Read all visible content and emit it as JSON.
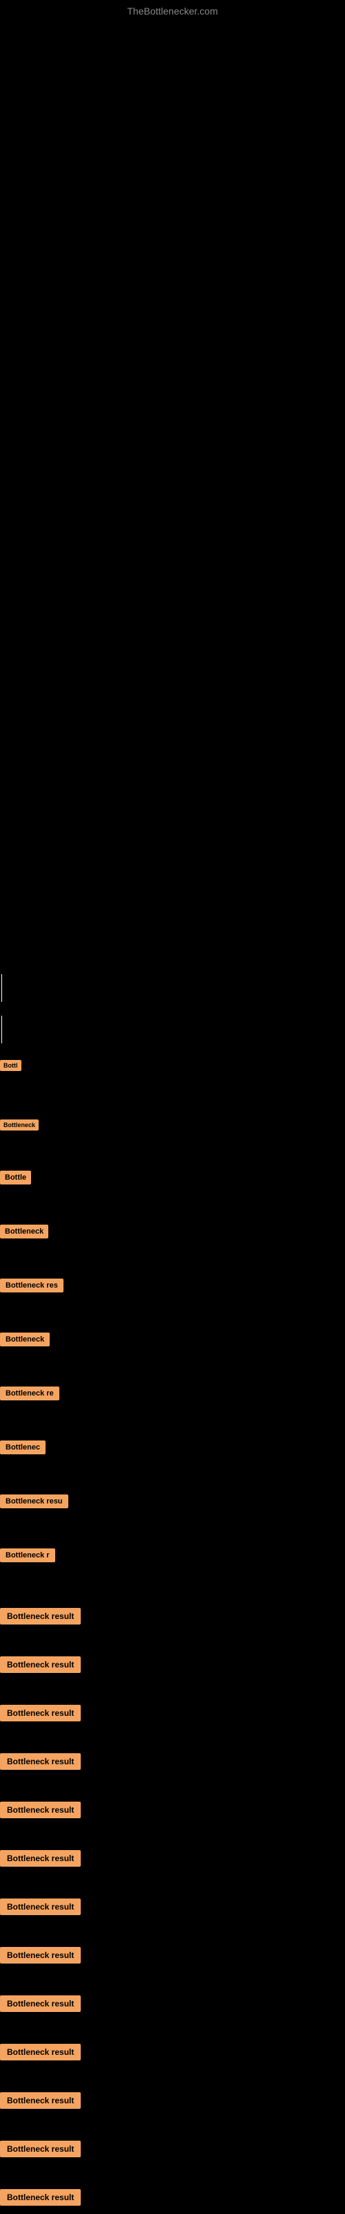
{
  "site": {
    "title": "TheBottlenecker.com"
  },
  "results": {
    "early_items": [
      {
        "id": 1,
        "label": "Bottl"
      },
      {
        "id": 2,
        "label": "Bottleneck"
      },
      {
        "id": 3,
        "label": "Bottle"
      },
      {
        "id": 4,
        "label": "Bottleneck"
      },
      {
        "id": 5,
        "label": "Bottleneck res"
      },
      {
        "id": 6,
        "label": "Bottleneck"
      },
      {
        "id": 7,
        "label": "Bottleneck re"
      },
      {
        "id": 8,
        "label": "Bottlenec"
      },
      {
        "id": 9,
        "label": "Bottleneck resu"
      },
      {
        "id": 10,
        "label": "Bottleneck r"
      }
    ],
    "full_items": [
      {
        "id": 11,
        "label": "Bottleneck result"
      },
      {
        "id": 12,
        "label": "Bottleneck result"
      },
      {
        "id": 13,
        "label": "Bottleneck result"
      },
      {
        "id": 14,
        "label": "Bottleneck result"
      },
      {
        "id": 15,
        "label": "Bottleneck result"
      },
      {
        "id": 16,
        "label": "Bottleneck result"
      },
      {
        "id": 17,
        "label": "Bottleneck result"
      },
      {
        "id": 18,
        "label": "Bottleneck result"
      },
      {
        "id": 19,
        "label": "Bottleneck result"
      },
      {
        "id": 20,
        "label": "Bottleneck result"
      },
      {
        "id": 21,
        "label": "Bottleneck result"
      },
      {
        "id": 22,
        "label": "Bottleneck result"
      },
      {
        "id": 23,
        "label": "Bottleneck result"
      }
    ]
  }
}
